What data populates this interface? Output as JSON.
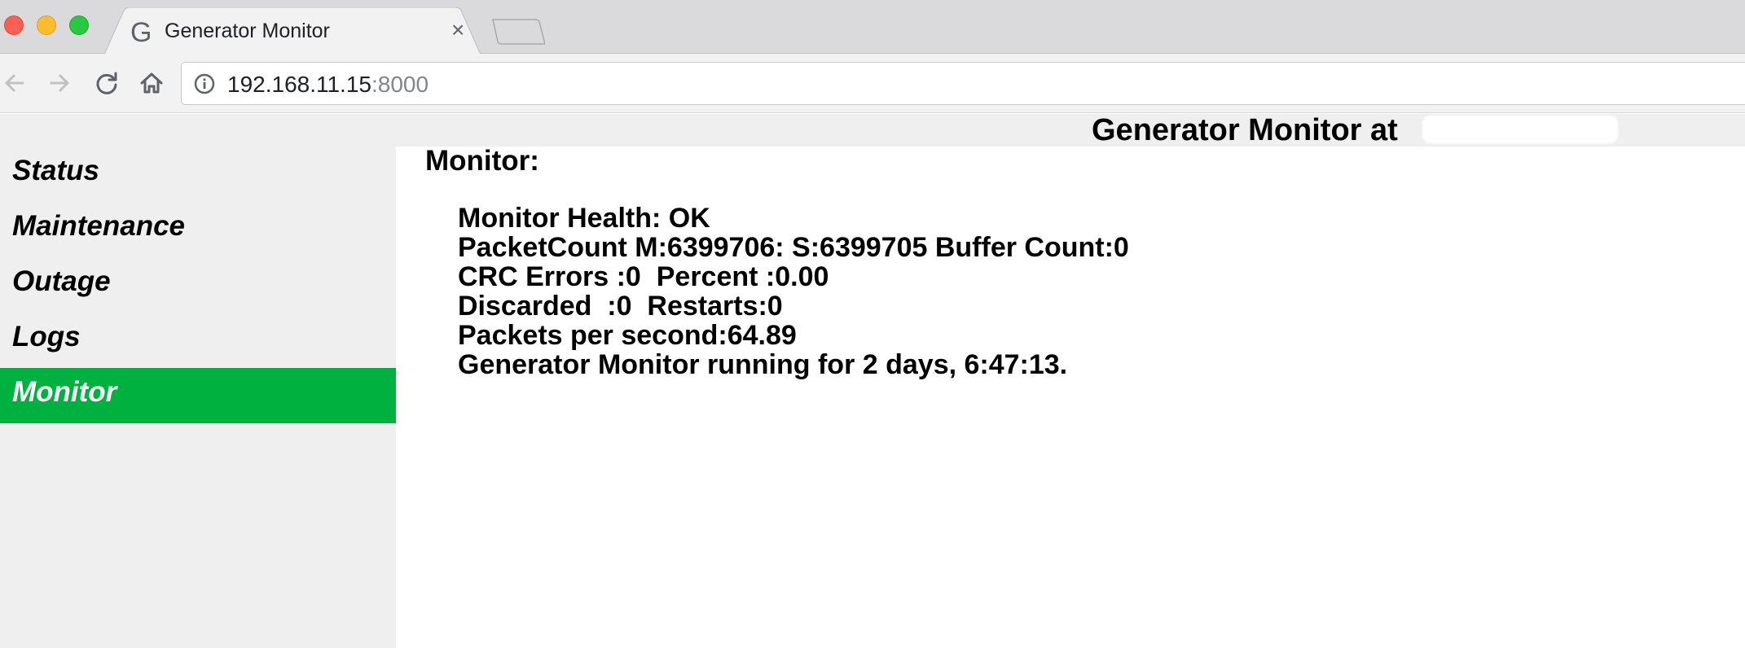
{
  "browser": {
    "tab": {
      "favicon": "G",
      "title": "Generator Monitor",
      "close_symbol": "×"
    },
    "url": {
      "host": "192.168.11.15",
      "port": ":8000"
    }
  },
  "page": {
    "title": "Generator Monitor at"
  },
  "sidebar": {
    "items": [
      {
        "label": "Status",
        "active": false
      },
      {
        "label": "Maintenance",
        "active": false
      },
      {
        "label": "Outage",
        "active": false
      },
      {
        "label": "Logs",
        "active": false
      },
      {
        "label": "Monitor",
        "active": true
      }
    ]
  },
  "monitor": {
    "heading": "Monitor:",
    "lines": [
      "Monitor Health: OK",
      "PacketCount M:6399706: S:6399705 Buffer Count:0",
      "CRC Errors :0  Percent :0.00",
      "Discarded  :0  Restarts:0",
      "Packets per second:64.89",
      "Generator Monitor running for 2 days, 6:47:13."
    ]
  },
  "colors": {
    "active_nav": "#00b140",
    "sidebar_bg": "#efefef"
  }
}
